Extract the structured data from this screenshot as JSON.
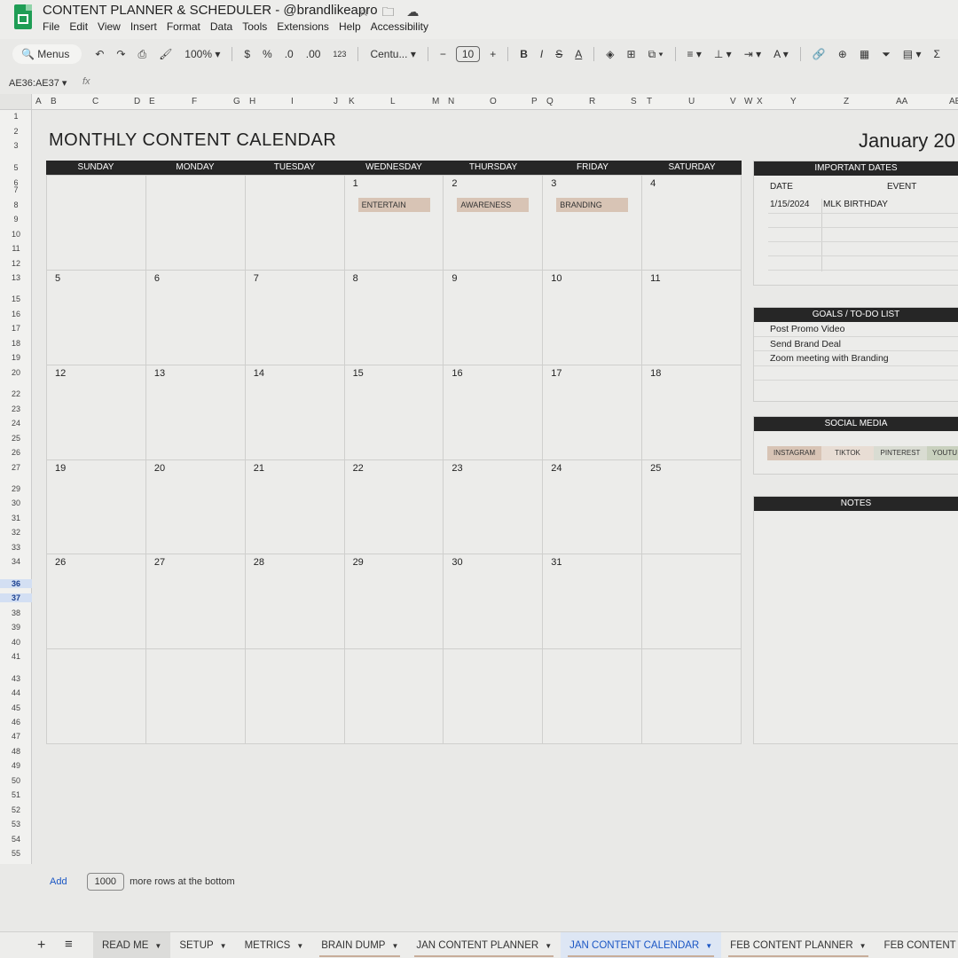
{
  "doc": {
    "title": "CONTENT PLANNER & SCHEDULER - @brandlikeapro",
    "menu": [
      "File",
      "Edit",
      "View",
      "Insert",
      "Format",
      "Data",
      "Tools",
      "Extensions",
      "Help",
      "Accessibility"
    ]
  },
  "toolbar": {
    "menus_label": "Menus",
    "zoom": "100%",
    "currency": "$",
    "percent": "%",
    "dec_decrease": ".0",
    "dec_increase": ".00",
    "number_format": "123",
    "font": "Centu...",
    "font_size": "10",
    "bold": "B",
    "italic": "I",
    "strike": "S",
    "text_color": "A",
    "sum": "Σ"
  },
  "formula": {
    "name_box": "AE36:AE37",
    "fx": "fx"
  },
  "columns": [
    "A",
    "B",
    "C",
    "D",
    "E",
    "F",
    "G",
    "H",
    "I",
    "J",
    "K",
    "L",
    "M",
    "N",
    "O",
    "P",
    "Q",
    "R",
    "S",
    "T",
    "U",
    "V",
    "W",
    "X",
    "Y",
    "Z",
    "AA",
    "AB"
  ],
  "rows": [
    "1",
    "2",
    "3",
    "5",
    "6",
    "7",
    "8",
    "9",
    "10",
    "11",
    "12",
    "13",
    "15",
    "16",
    "17",
    "18",
    "19",
    "20",
    "22",
    "23",
    "24",
    "25",
    "26",
    "27",
    "29",
    "30",
    "31",
    "32",
    "33",
    "34",
    "36",
    "37",
    "38",
    "39",
    "40",
    "41",
    "43",
    "44",
    "45",
    "46",
    "47",
    "48",
    "49",
    "50",
    "51",
    "52",
    "53",
    "54",
    "55"
  ],
  "calendar": {
    "title": "MONTHLY CONTENT CALENDAR",
    "month": "January 20",
    "days": [
      "SUNDAY",
      "MONDAY",
      "TUESDAY",
      "WEDNESDAY",
      "THURSDAY",
      "FRIDAY",
      "SATURDAY"
    ],
    "cells": [
      {
        "n": ""
      },
      {
        "n": ""
      },
      {
        "n": ""
      },
      {
        "n": "1",
        "tag": "ENTERTAIN"
      },
      {
        "n": "2",
        "tag": "AWARENESS"
      },
      {
        "n": "3",
        "tag": "BRANDING"
      },
      {
        "n": "4"
      },
      {
        "n": "5"
      },
      {
        "n": "6"
      },
      {
        "n": "7"
      },
      {
        "n": "8"
      },
      {
        "n": "9"
      },
      {
        "n": "10"
      },
      {
        "n": "11"
      },
      {
        "n": "12"
      },
      {
        "n": "13"
      },
      {
        "n": "14"
      },
      {
        "n": "15"
      },
      {
        "n": "16"
      },
      {
        "n": "17"
      },
      {
        "n": "18"
      },
      {
        "n": "19"
      },
      {
        "n": "20"
      },
      {
        "n": "21"
      },
      {
        "n": "22"
      },
      {
        "n": "23"
      },
      {
        "n": "24"
      },
      {
        "n": "25"
      },
      {
        "n": "26"
      },
      {
        "n": "27"
      },
      {
        "n": "28"
      },
      {
        "n": "29"
      },
      {
        "n": "30"
      },
      {
        "n": "31"
      },
      {
        "n": ""
      },
      {
        "n": ""
      },
      {
        "n": ""
      },
      {
        "n": ""
      },
      {
        "n": ""
      },
      {
        "n": ""
      },
      {
        "n": ""
      },
      {
        "n": ""
      }
    ]
  },
  "important_dates": {
    "title": "IMPORTANT DATES",
    "date_header": "DATE",
    "event_header": "EVENT",
    "rows": [
      {
        "date": "1/15/2024",
        "event": "MLK BIRTHDAY"
      }
    ]
  },
  "goals": {
    "title": "GOALS / TO-DO LIST",
    "items": [
      "Post Promo Video",
      "Send Brand Deal",
      "Zoom meeting with Branding",
      ""
    ]
  },
  "social": {
    "title": "SOCIAL MEDIA",
    "items": [
      {
        "label": "INSTAGRAM",
        "color": "#d8c4b5"
      },
      {
        "label": "TIKTOK",
        "color": "#e8ddd4"
      },
      {
        "label": "PINTEREST",
        "color": "#d9dcd2"
      },
      {
        "label": "YOUTU",
        "color": "#c9d1be"
      }
    ]
  },
  "notes": {
    "title": "NOTES"
  },
  "add_rows": {
    "add": "Add",
    "count": "1000",
    "suffix": "more rows at the bottom"
  },
  "sheets": [
    "READ ME",
    "SETUP",
    "METRICS",
    "BRAIN DUMP",
    "JAN CONTENT PLANNER",
    "JAN CONTENT CALENDAR",
    "FEB CONTENT PLANNER",
    "FEB CONTENT CAL"
  ],
  "active_sheet": "JAN CONTENT CALENDAR"
}
